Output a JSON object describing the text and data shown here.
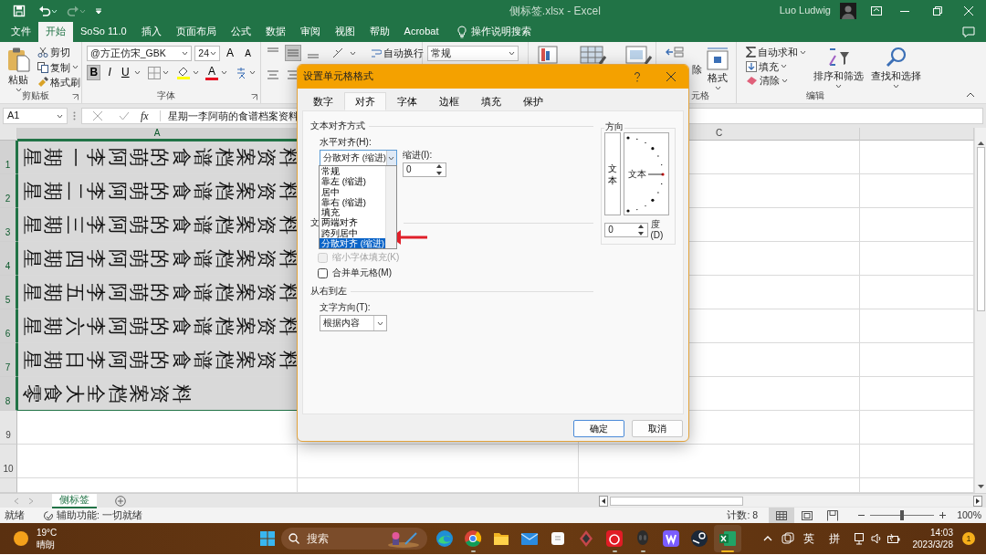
{
  "window": {
    "title": "侧标签.xlsx  -  Excel",
    "user": "Luo Ludwig"
  },
  "ribbon_tabs": [
    {
      "label": "文件",
      "selected": false
    },
    {
      "label": "开始",
      "selected": true
    },
    {
      "label": "SoSo 11.0",
      "selected": false
    },
    {
      "label": "插入",
      "selected": false
    },
    {
      "label": "页面布局",
      "selected": false
    },
    {
      "label": "公式",
      "selected": false
    },
    {
      "label": "数据",
      "selected": false
    },
    {
      "label": "审阅",
      "selected": false
    },
    {
      "label": "视图",
      "selected": false
    },
    {
      "label": "帮助",
      "selected": false
    },
    {
      "label": "Acrobat",
      "selected": false
    }
  ],
  "tell_me": "操作说明搜索",
  "ribbon": {
    "clipboard": {
      "paste": "粘贴",
      "cut": "剪切",
      "copy": "复制",
      "format_painter": "格式刷",
      "label": "剪贴板"
    },
    "font": {
      "name": "@方正仿宋_GBK",
      "size": "24",
      "grow": "A",
      "shrink": "A",
      "font_color": "A",
      "label": "字体",
      "styles": [
        {
          "label": "B",
          "selected": true
        },
        {
          "label": "I",
          "selected": false
        },
        {
          "label": "U",
          "selected": false
        }
      ]
    },
    "alignment": {
      "wrap_text": "自动换行"
    },
    "number": {
      "format": "常规"
    },
    "cells": {
      "delete": "除",
      "format": "格式",
      "label": "元格"
    },
    "editing": {
      "autosum": "自动求和",
      "fill": "填充",
      "clear": "清除",
      "sort": "排序和筛选",
      "find": "查找和选择",
      "label": "编辑"
    }
  },
  "formula_bar": {
    "name_box": "A1",
    "function_label": "fx",
    "formula": "星期一李阿萌的食谱档案资料"
  },
  "columns": [
    {
      "label": "A",
      "selected": true
    },
    {
      "label": "C",
      "selected": false
    }
  ],
  "rows": [
    {
      "header": "1",
      "selected": true,
      "cell": "星期一李阿萌的食谱档案资料"
    },
    {
      "header": "2",
      "selected": true,
      "cell": "星期二李阿萌的食谱档案资料"
    },
    {
      "header": "3",
      "selected": true,
      "cell": "星期三李阿萌的食谱档案资料"
    },
    {
      "header": "4",
      "selected": true,
      "cell": "星期四李阿萌的食谱档案资料"
    },
    {
      "header": "5",
      "selected": true,
      "cell": "星期五李阿萌的食谱档案资料"
    },
    {
      "header": "6",
      "selected": true,
      "cell": "星期六李阿萌的食谱档案资料"
    },
    {
      "header": "7",
      "selected": true,
      "cell": "星期日李阿萌的食谱档案资料"
    },
    {
      "header": "8",
      "selected": true,
      "cell": "零食大全档案资料"
    },
    {
      "header": "9",
      "selected": false
    },
    {
      "header": "10",
      "selected": false
    }
  ],
  "sheet_tabs": [
    {
      "label": "侧标签",
      "selected": true
    }
  ],
  "status_bar": {
    "ready": "就绪",
    "accessibility": "辅助功能: 一切就绪",
    "count": "计数: 8",
    "zoom": "100%",
    "level": 0.5
  },
  "dialog": {
    "title": "设置单元格格式",
    "tabs": [
      {
        "label": "数字",
        "selected": false
      },
      {
        "label": "对齐",
        "selected": true
      },
      {
        "label": "字体",
        "selected": false
      },
      {
        "label": "边框",
        "selected": false
      },
      {
        "label": "填充",
        "selected": false
      },
      {
        "label": "保护",
        "selected": false
      }
    ],
    "text_alignment": {
      "heading": "文本对齐方式",
      "horizontal_label": "水平对齐(H):",
      "horizontal_value": "分散对齐 (缩进)",
      "indent_label": "缩进(I):",
      "indent_value": "0",
      "options": [
        {
          "label": "常规",
          "selected": false
        },
        {
          "label": "靠左 (缩进)",
          "selected": false
        },
        {
          "label": "居中",
          "selected": false
        },
        {
          "label": "靠右 (缩进)",
          "selected": false
        },
        {
          "label": "填充",
          "selected": false
        },
        {
          "label": "两端对齐",
          "selected": false
        },
        {
          "label": "跨列居中",
          "selected": false
        },
        {
          "label": "分散对齐 (缩进)",
          "selected": true
        }
      ]
    },
    "text_control": {
      "heading": "文",
      "checks": [
        {
          "label": "缩小字体填充(K)",
          "checked": false,
          "disabled": true
        },
        {
          "label": "合并单元格(M)",
          "checked": false,
          "disabled": false
        }
      ]
    },
    "rtl": {
      "heading": "从右到左",
      "direction_label": "文字方向(T):",
      "direction_value": "根据内容"
    },
    "orientation": {
      "heading": "方向",
      "vertical_text": "文本",
      "dial_text": "文本",
      "degrees": "0",
      "degrees_label": "度(D)"
    },
    "buttons": [
      {
        "label": "确定",
        "kind": "primary"
      },
      {
        "label": "取消",
        "kind": "secondary"
      }
    ]
  },
  "taskbar": {
    "temperature": "19°C",
    "condition": "晴朗",
    "search_placeholder": "搜索",
    "apps": [
      {
        "kind": "edge",
        "running": false,
        "selected": false
      },
      {
        "kind": "chrome",
        "running": true,
        "selected": false
      },
      {
        "kind": "folder",
        "running": false,
        "selected": false
      },
      {
        "kind": "mail",
        "running": false,
        "selected": false
      },
      {
        "kind": "note",
        "running": false,
        "selected": false
      },
      {
        "kind": "game",
        "running": false,
        "selected": false
      },
      {
        "kind": "music",
        "running": true,
        "selected": false
      },
      {
        "kind": "alien",
        "running": true,
        "selected": false
      },
      {
        "kind": "wapp",
        "running": false,
        "selected": false
      },
      {
        "kind": "steam",
        "running": false,
        "selected": false
      },
      {
        "kind": "excel",
        "running": true,
        "selected": true
      }
    ],
    "ime_language": "英",
    "ime_mode": "拼",
    "time": "14:03",
    "date": "2023/3/28",
    "notifications": "1"
  }
}
